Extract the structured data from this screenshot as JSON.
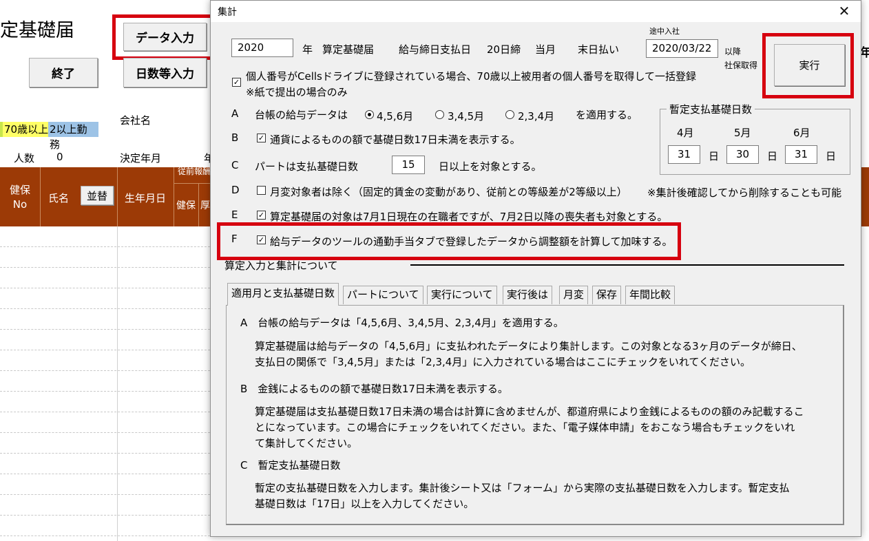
{
  "sheet": {
    "title": "定基礎届",
    "data_input_btn": "データ入力",
    "exit_btn": "終了",
    "days_input_btn": "日数等入力",
    "legend_70": "70歳以上",
    "legend_2jobs": "2以上勤務",
    "company_label": "会社名",
    "count_label": "人数",
    "count_value": "0",
    "decision_label": "決定年月",
    "decision_partial": "年",
    "col_kenpo": "健保\nNo",
    "col_name": "氏名",
    "sort_btn": "並替",
    "col_birth": "生年月日",
    "col_kenpo2": "健保",
    "col_kosei": "厚",
    "col_top_partial": "従前報酬",
    "right_partial": "年",
    "colors": {
      "header": "#9c3a06",
      "legend_70": "#ffff66",
      "legend_2jobs": "#9dc3e6"
    }
  },
  "dialog": {
    "title": "集計",
    "year_value": "2020",
    "year_label": "年",
    "santei_label": "算定基礎届",
    "pay_close_label": "給与締日支払日",
    "close_day": "20日締",
    "this_month": "当月",
    "end_pay": "末日払い",
    "midway_small": "途中入社",
    "midway_date": "2020/03/22",
    "after_label": "以降",
    "after_label2": "社保取得",
    "exec_btn": "実行",
    "mynumber_text": "個人番号がCellsドライブに登録されている場合、70歳以上被用者の個人番号を取得して一括登録",
    "mynumber_note": "※紙で提出の場合のみ",
    "rows": {
      "A": {
        "letter": "A",
        "text": "台帳の給与データは",
        "opt1": "4,5,6月",
        "opt2": "3,4,5月",
        "opt3": "2,3,4月",
        "suffix": "を適用する。"
      },
      "B": {
        "letter": "B",
        "text": "通貨によるものの額で基礎日数17日未満を表示する。"
      },
      "C": {
        "letter": "C",
        "text": "パートは支払基礎日数",
        "value": "15",
        "suffix": "日以上を対象とする。"
      },
      "D": {
        "letter": "D",
        "text": "月変対象者は除く（固定的賃金の変動があり、従前との等級差が2等級以上）",
        "note": "※集計後確認してから削除することも可能"
      },
      "E": {
        "letter": "E",
        "text": "算定基礎届の対象は7月1日現在の在職者ですが、7月2日以降の喪失者も対象とする。"
      },
      "F": {
        "letter": "F",
        "text": "給与データのツールの通勤手当タブで登録したデータから調整額を計算して加味する。"
      }
    },
    "provisional": {
      "title": "暫定支払基礎日数",
      "m4": "4月",
      "m5": "5月",
      "m6": "6月",
      "v4": "31",
      "v5": "30",
      "v6": "31",
      "day": "日"
    },
    "section_title": "算定入力と集計について",
    "tabs": [
      "適用月と支払基礎日数",
      "パートについて",
      "実行について",
      "実行後は",
      "月変",
      "保存",
      "年間比較"
    ],
    "content": {
      "a_head": "A　台帳の給与データは「4,5,6月、3,4,5月、2,3,4月」を適用する。",
      "a_body1": "算定基礎届は給与データの「4,5,6月」に支払われたデータにより集計します。この対象となる3ヶ月のデータが締日、",
      "a_body2": "支払日の関係で「3,4,5月」または「2,3,4月」に入力されている場合はここにチェックをいれてください。",
      "b_head": "B　金銭によるものの額で基礎日数17日未満を表示する。",
      "b_body1": "算定基礎届は支払基礎日数17日未満の場合は計算に含めませんが、都道府県により金銭によるものの額のみ記載するこ",
      "b_body2": "とになっています。この場合にチェックをいれてください。また、「電子媒体申請」をおこなう場合もチェックをいれ",
      "b_body3": "て集計してください。",
      "c_head": "C　暫定支払基礎日数",
      "c_body1": "暫定の支払基礎日数を入力します。集計後シート又は「フォーム」から実際の支払基礎日数を入力します。暫定支払",
      "c_body2": "基礎日数は「17日」以上を入力してください。"
    }
  },
  "highlight_color": "#d6000f"
}
